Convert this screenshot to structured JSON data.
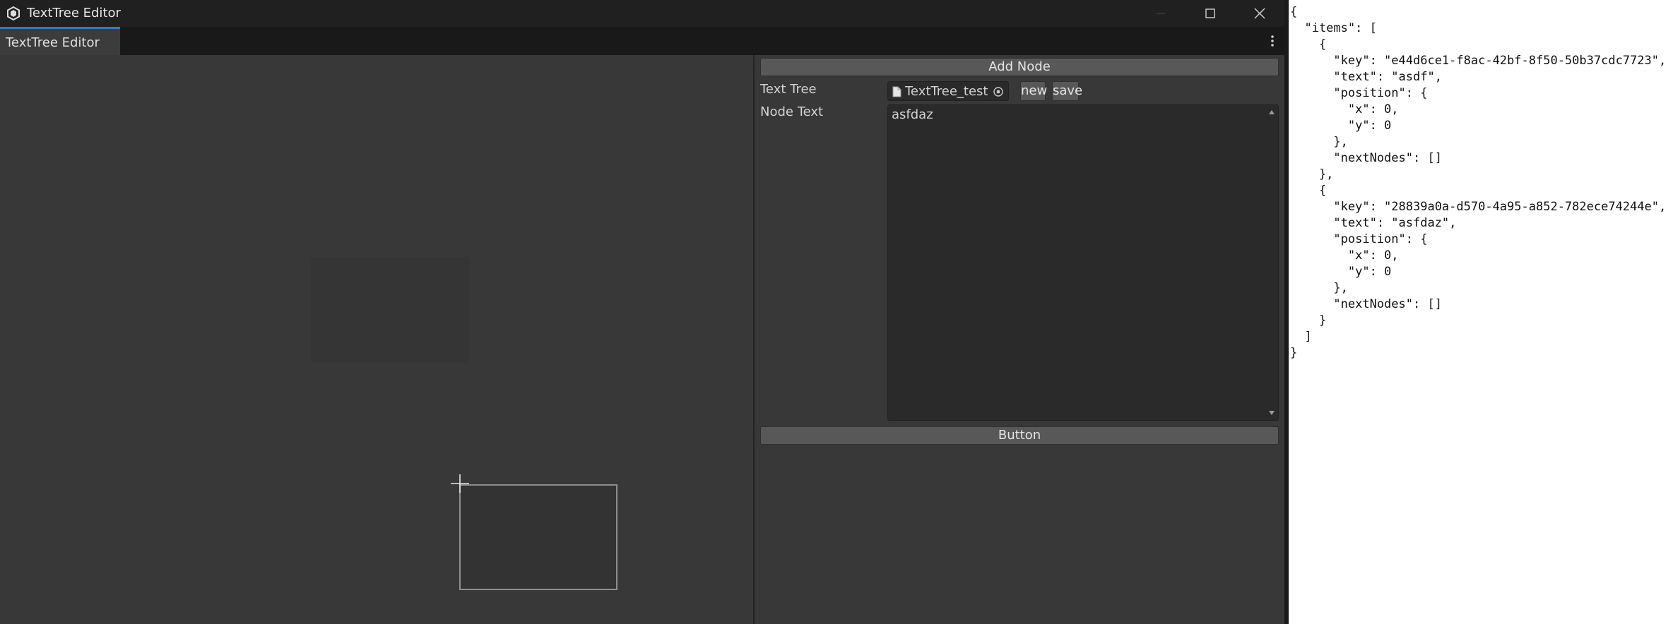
{
  "window": {
    "title": "TextTree Editor",
    "tab_label": "TextTree Editor"
  },
  "inspector": {
    "add_node_label": "Add Node",
    "text_tree_label": "Text Tree",
    "text_tree_value": "TextTree_test",
    "new_label": "new",
    "save_label": "save",
    "node_text_label": "Node Text",
    "node_text_value": "asfdaz",
    "button_label": "Button"
  },
  "json_lines": [
    "{",
    "  \"items\": [",
    "    {",
    "      \"key\": \"e44d6ce1-f8ac-42bf-8f50-50b37cdc7723\",",
    "      \"text\": \"asdf\",",
    "      \"position\": {",
    "        \"x\": 0,",
    "        \"y\": 0",
    "      },",
    "      \"nextNodes\": []",
    "    },",
    "    {",
    "      \"key\": \"28839a0a-d570-4a95-a852-782ece74244e\",",
    "      \"text\": \"asfdaz\",",
    "      \"position\": {",
    "        \"x\": 0,",
    "        \"y\": 0",
    "      },",
    "      \"nextNodes\": []",
    "    }",
    "  ]",
    "}"
  ],
  "icons": {
    "app": "unity-logo-icon",
    "minimize": "minimize-icon",
    "maximize": "maximize-icon",
    "close": "close-icon",
    "menu": "kebab-menu-icon",
    "asset": "document-icon",
    "picker": "object-picker-icon",
    "cursor": "crosshair-cursor-icon"
  },
  "colors": {
    "accent": "#3a79bb",
    "panel": "#383838",
    "titlebar": "#202020"
  }
}
